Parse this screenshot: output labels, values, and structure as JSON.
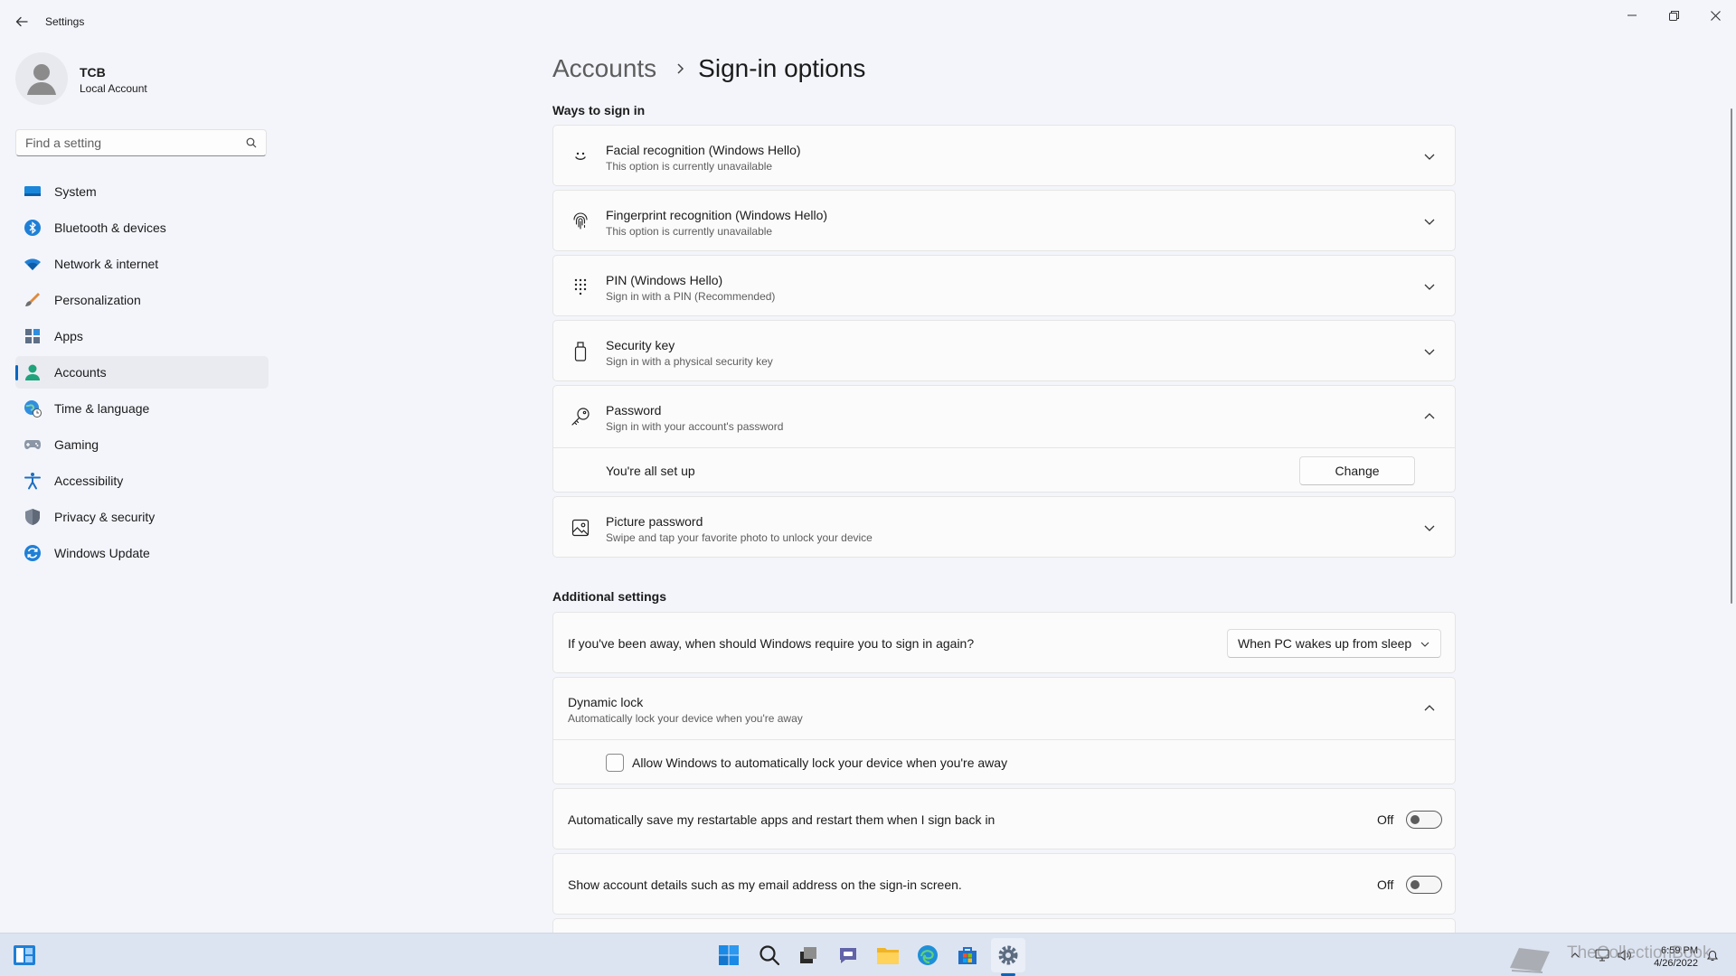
{
  "app": {
    "title": "Settings",
    "window_controls": [
      "minimize",
      "restore",
      "close"
    ]
  },
  "profile": {
    "name": "TCB",
    "account_type": "Local Account"
  },
  "search": {
    "placeholder": "Find a setting"
  },
  "sidebar": {
    "items": [
      {
        "label": "System",
        "icon": "monitor-icon"
      },
      {
        "label": "Bluetooth & devices",
        "icon": "bluetooth-icon"
      },
      {
        "label": "Network & internet",
        "icon": "wifi-icon"
      },
      {
        "label": "Personalization",
        "icon": "brush-icon"
      },
      {
        "label": "Apps",
        "icon": "apps-icon"
      },
      {
        "label": "Accounts",
        "icon": "person-icon",
        "active": true
      },
      {
        "label": "Time & language",
        "icon": "globe-clock-icon"
      },
      {
        "label": "Gaming",
        "icon": "gamepad-icon"
      },
      {
        "label": "Accessibility",
        "icon": "accessibility-icon"
      },
      {
        "label": "Privacy & security",
        "icon": "shield-icon"
      },
      {
        "label": "Windows Update",
        "icon": "update-icon"
      }
    ]
  },
  "breadcrumb": {
    "parent": "Accounts",
    "current": "Sign-in options"
  },
  "ways_to_sign_in": {
    "heading": "Ways to sign in",
    "options": [
      {
        "title": "Facial recognition (Windows Hello)",
        "subtitle": "This option is currently unavailable",
        "icon": "face-icon",
        "expanded": false
      },
      {
        "title": "Fingerprint recognition (Windows Hello)",
        "subtitle": "This option is currently unavailable",
        "icon": "fingerprint-icon",
        "expanded": false
      },
      {
        "title": "PIN (Windows Hello)",
        "subtitle": "Sign in with a PIN (Recommended)",
        "icon": "pin-keypad-icon",
        "expanded": false
      },
      {
        "title": "Security key",
        "subtitle": "Sign in with a physical security key",
        "icon": "usb-key-icon",
        "expanded": false
      },
      {
        "title": "Password",
        "subtitle": "Sign in with your account's password",
        "icon": "key-icon",
        "expanded": true
      },
      {
        "title": "Picture password",
        "subtitle": "Swipe and tap your favorite photo to unlock your device",
        "icon": "picture-icon",
        "expanded": false
      }
    ],
    "password_detail": {
      "status": "You're all set up",
      "button": "Change"
    }
  },
  "additional_settings": {
    "heading": "Additional settings",
    "require_sign_in": {
      "label": "If you've been away, when should Windows require you to sign in again?",
      "selected": "When PC wakes up from sleep"
    },
    "dynamic_lock": {
      "title": "Dynamic lock",
      "subtitle": "Automatically lock your device when you're away",
      "checkbox_label": "Allow Windows to automatically lock your device when you're away",
      "checked": false
    },
    "restart_apps": {
      "label": "Automatically save my restartable apps and restart them when I sign back in",
      "state": "Off"
    },
    "account_details": {
      "label": "Show account details such as my email address on the sign-in screen.",
      "state": "Off"
    }
  },
  "taskbar": {
    "apps": [
      "widgets-icon",
      "start-icon",
      "search-icon",
      "task-view-icon",
      "chat-icon",
      "file-explorer-icon",
      "edge-icon",
      "store-icon",
      "settings-icon"
    ],
    "clock": {
      "time": "6:59 PM",
      "date": "4/26/2022"
    },
    "watermark": "TheCollectionBook"
  },
  "colors": {
    "accent": "#0067c0",
    "background": "#f3f5fb",
    "card": "#fbfbfb"
  }
}
